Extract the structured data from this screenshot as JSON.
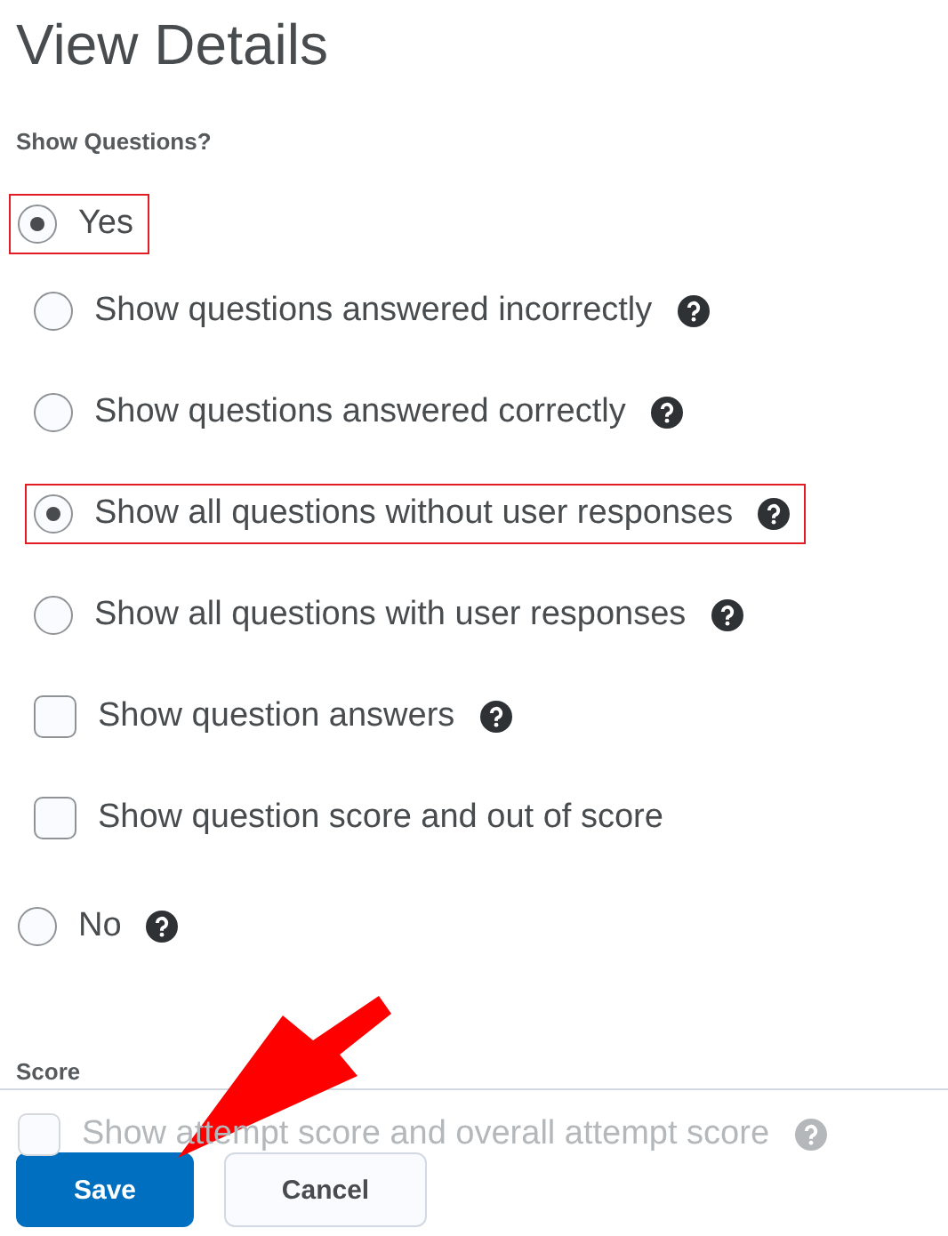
{
  "title": "View Details",
  "show_questions": {
    "label": "Show Questions?",
    "options": [
      {
        "kind": "radio",
        "label": "Yes",
        "selected": true,
        "highlighted": true,
        "help": false,
        "children": [
          {
            "kind": "radio",
            "label": "Show questions answered incorrectly",
            "selected": false,
            "highlighted": false,
            "help": true
          },
          {
            "kind": "radio",
            "label": "Show questions answered correctly",
            "selected": false,
            "highlighted": false,
            "help": true
          },
          {
            "kind": "radio",
            "label": "Show all questions without user responses",
            "selected": true,
            "highlighted": true,
            "help": true
          },
          {
            "kind": "radio",
            "label": "Show all questions with user responses",
            "selected": false,
            "highlighted": false,
            "help": true
          },
          {
            "kind": "checkbox",
            "label": "Show question answers",
            "checked": false,
            "highlighted": false,
            "help": true
          },
          {
            "kind": "checkbox",
            "label": "Show question score and out of score",
            "checked": false,
            "highlighted": false,
            "help": false
          }
        ]
      },
      {
        "kind": "radio",
        "label": "No",
        "selected": false,
        "highlighted": false,
        "help": true
      }
    ]
  },
  "score": {
    "label": "Score",
    "options": [
      {
        "kind": "checkbox",
        "label": "Show attempt score and overall attempt score",
        "checked": false,
        "highlighted": false,
        "help": true
      }
    ]
  },
  "buttons": [
    {
      "label": "Save",
      "kind": "primary"
    },
    {
      "label": "Cancel",
      "kind": "secondary"
    }
  ]
}
